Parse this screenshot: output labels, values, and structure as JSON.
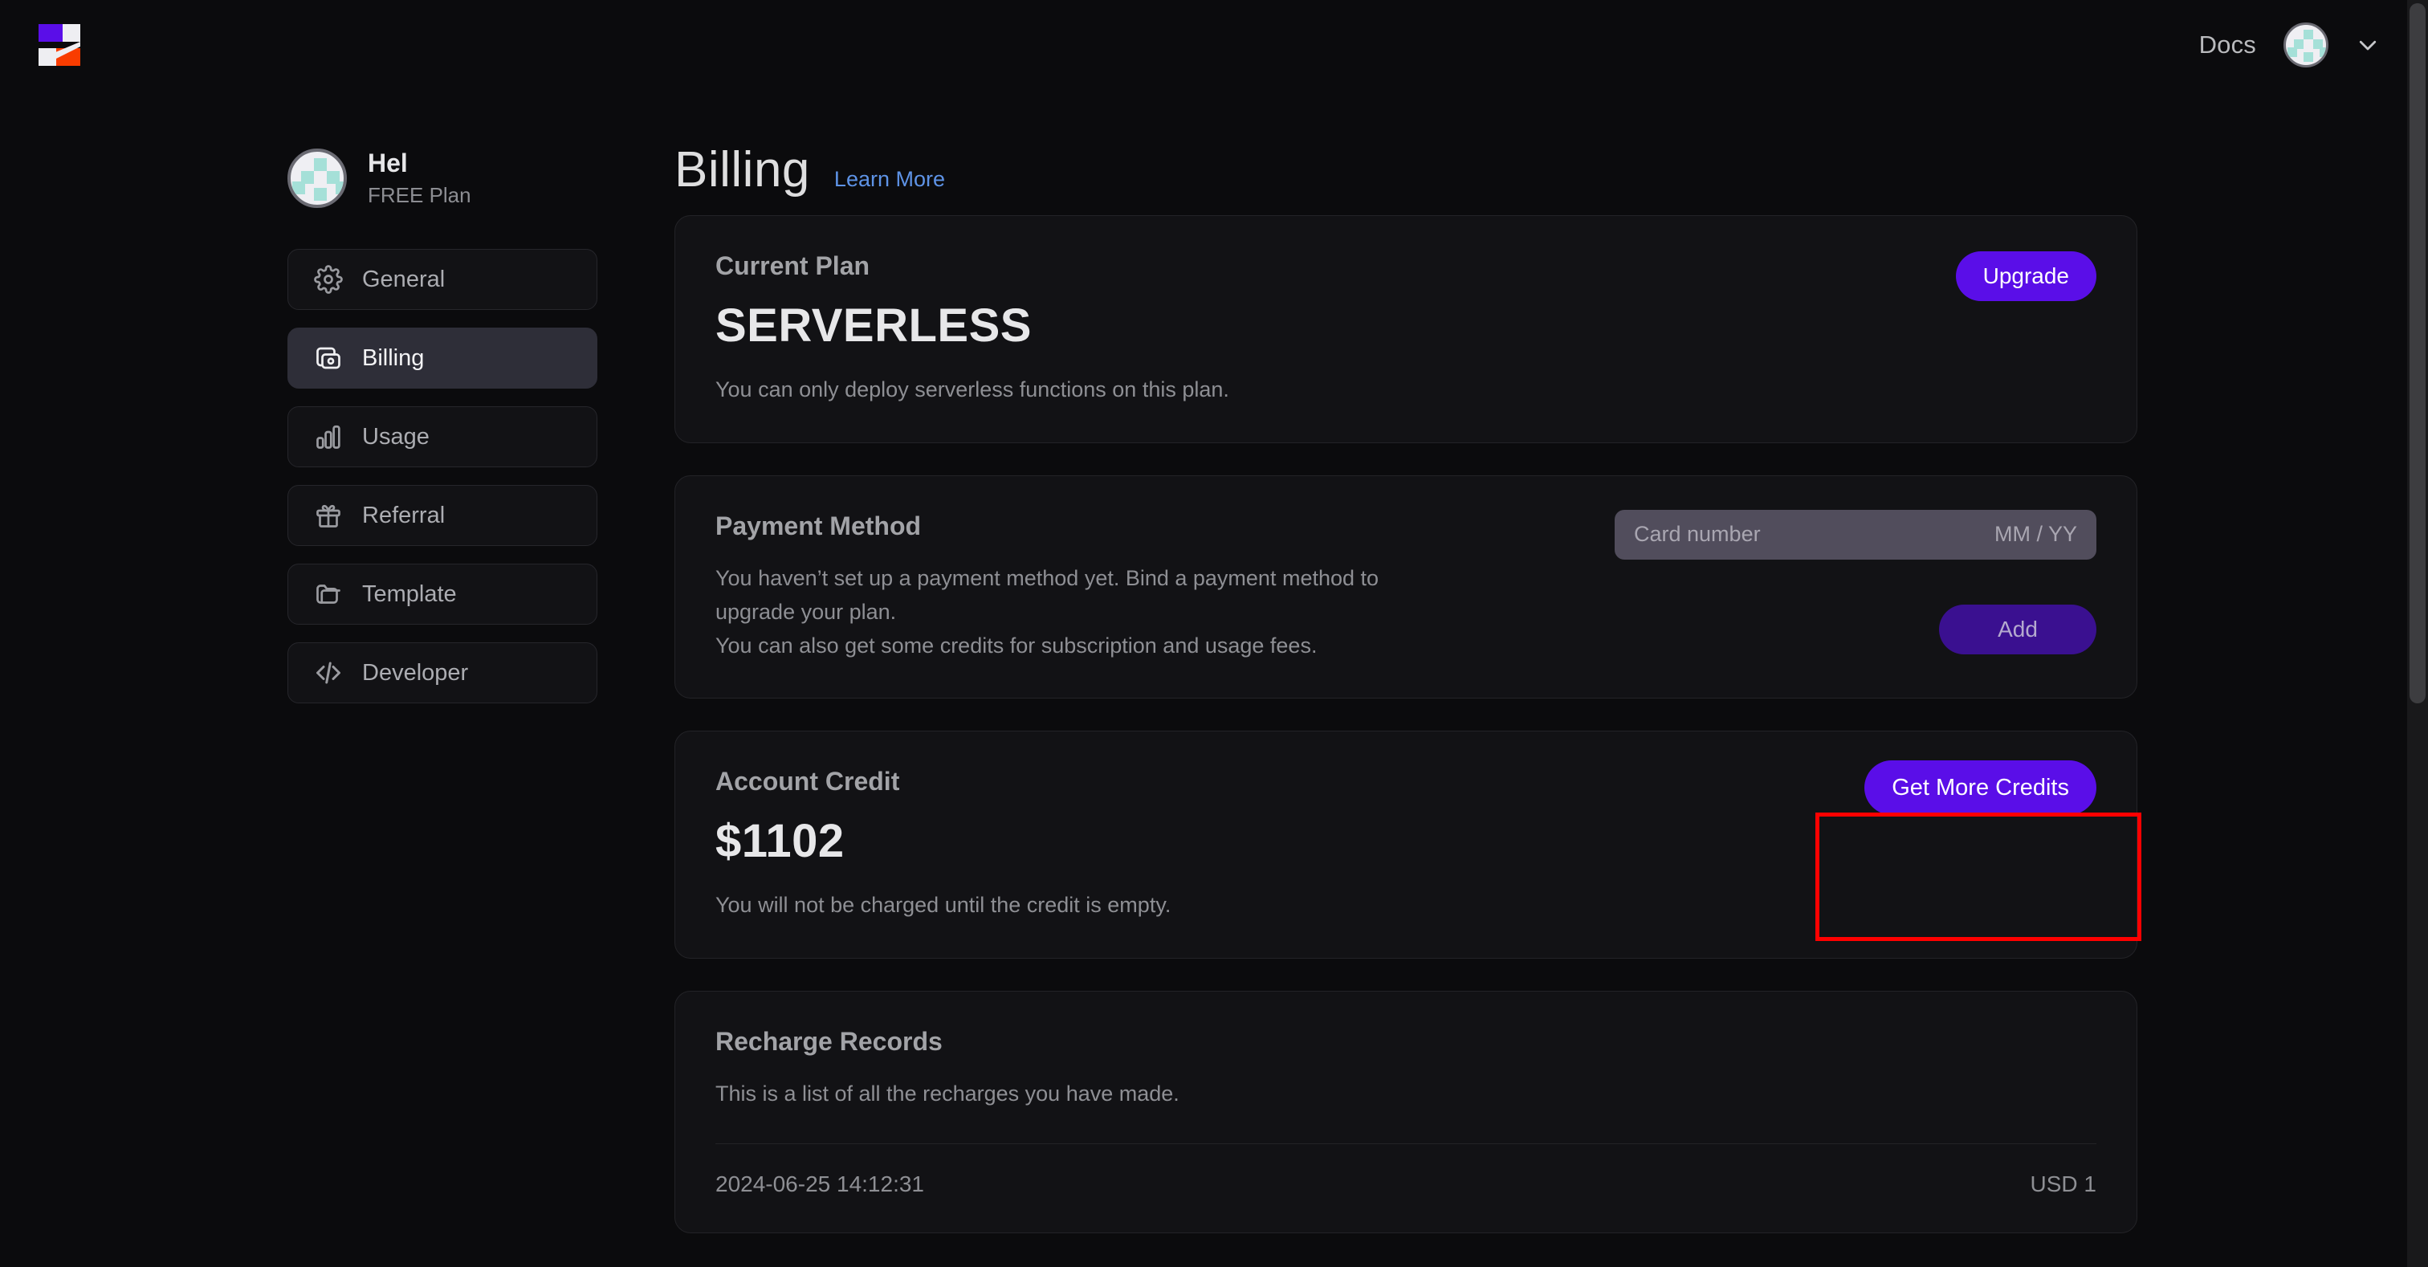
{
  "topbar": {
    "docs_label": "Docs",
    "logo_name": "sealos-logo",
    "avatar_name": "user-avatar",
    "chevron_name": "chevron-down-icon"
  },
  "sidebar": {
    "account": {
      "name": "Hel",
      "plan": "FREE Plan"
    },
    "items": [
      {
        "label": "General",
        "icon": "gear-icon",
        "active": false
      },
      {
        "label": "Billing",
        "icon": "wallet-icon",
        "active": true
      },
      {
        "label": "Usage",
        "icon": "bar-chart-icon",
        "active": false
      },
      {
        "label": "Referral",
        "icon": "gift-icon",
        "active": false
      },
      {
        "label": "Template",
        "icon": "folder-icon",
        "active": false
      },
      {
        "label": "Developer",
        "icon": "code-icon",
        "active": false
      }
    ]
  },
  "main": {
    "title": "Billing",
    "learn_more": "Learn More",
    "current_plan": {
      "title": "Current Plan",
      "plan_name": "SERVERLESS",
      "description": "You can only deploy serverless functions on this plan.",
      "upgrade_label": "Upgrade"
    },
    "payment_method": {
      "title": "Payment Method",
      "description_line1": "You haven’t set up a payment method yet. Bind a payment method to",
      "description_line2": "upgrade your plan.",
      "description_line3": "You can also get some credits for subscription and usage fees.",
      "card_number_placeholder": "Card number",
      "expiry_placeholder": "MM / YY",
      "card_number_value": "",
      "add_label": "Add"
    },
    "account_credit": {
      "title": "Account Credit",
      "amount": "$1102",
      "description": "You will not be charged until the credit is empty.",
      "get_more_label": "Get More Credits"
    },
    "recharge_records": {
      "title": "Recharge Records",
      "description": "This is a list of all the recharges you have made.",
      "rows": [
        {
          "date": "2024-06-25 14:12:31",
          "amount": "USD 1"
        }
      ]
    }
  },
  "colors": {
    "page_bg": "#0b0b0d",
    "card_bg": "#121215",
    "card_border": "#232327",
    "accent_purple": "#5a0ee8",
    "accent_purple_dim": "#3a1090",
    "link_blue": "#5e93e6",
    "active_nav_bg": "#2e2e38",
    "highlight_red": "#ff0000",
    "avatar_tile": "#a5e0d8"
  },
  "annotation": {
    "name": "get-more-credits-highlight"
  }
}
